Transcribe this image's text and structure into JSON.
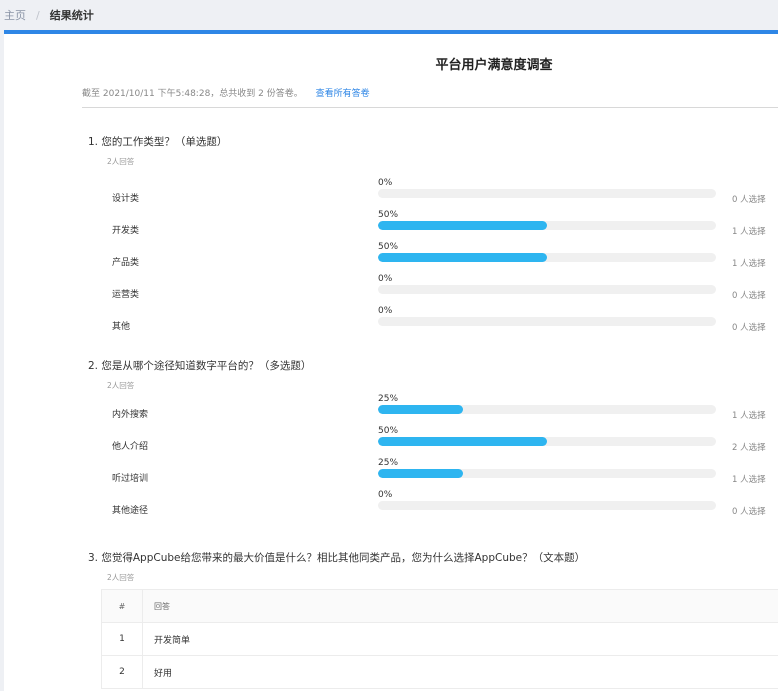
{
  "breadcrumb": {
    "home": "主页",
    "separator": "/",
    "current": "结果统计"
  },
  "survey": {
    "title": "平台用户满意度调查",
    "summary": "截至 2021/10/11 下午5:48:28，总共收到 2 份答卷。",
    "view_all_link": "查看所有答卷"
  },
  "questions": [
    {
      "title": "1.  您的工作类型？（单选题）",
      "count": "2人回答",
      "options": [
        {
          "label": "设计类",
          "percent": "0%",
          "value": 0,
          "selected": "0 人选择"
        },
        {
          "label": "开发类",
          "percent": "50%",
          "value": 50,
          "selected": "1 人选择"
        },
        {
          "label": "产品类",
          "percent": "50%",
          "value": 50,
          "selected": "1 人选择"
        },
        {
          "label": "运营类",
          "percent": "0%",
          "value": 0,
          "selected": "0 人选择"
        },
        {
          "label": "其他",
          "percent": "0%",
          "value": 0,
          "selected": "0 人选择"
        }
      ]
    },
    {
      "title": "2.  您是从哪个途径知道数字平台的？（多选题）",
      "count": "2人回答",
      "options": [
        {
          "label": "内外搜索",
          "percent": "25%",
          "value": 25,
          "selected": "1 人选择"
        },
        {
          "label": "他人介绍",
          "percent": "50%",
          "value": 50,
          "selected": "2 人选择"
        },
        {
          "label": "听过培训",
          "percent": "25%",
          "value": 25,
          "selected": "1 人选择"
        },
        {
          "label": "其他途径",
          "percent": "0%",
          "value": 0,
          "selected": "0 人选择"
        }
      ]
    },
    {
      "title": "3.  您觉得AppCube给您带来的最大价值是什么？相比其他同类产品，您为什么选择AppCube？（文本题）",
      "count": "2人回答",
      "table": {
        "headers": [
          "#",
          "回答"
        ],
        "rows": [
          {
            "index": "1",
            "answer": "开发简单"
          },
          {
            "index": "2",
            "answer": "好用"
          }
        ]
      }
    }
  ],
  "colors": {
    "accent": "#2e86e6",
    "bar_fill": "#2eb5f0",
    "bar_track": "#f0f0f0"
  }
}
